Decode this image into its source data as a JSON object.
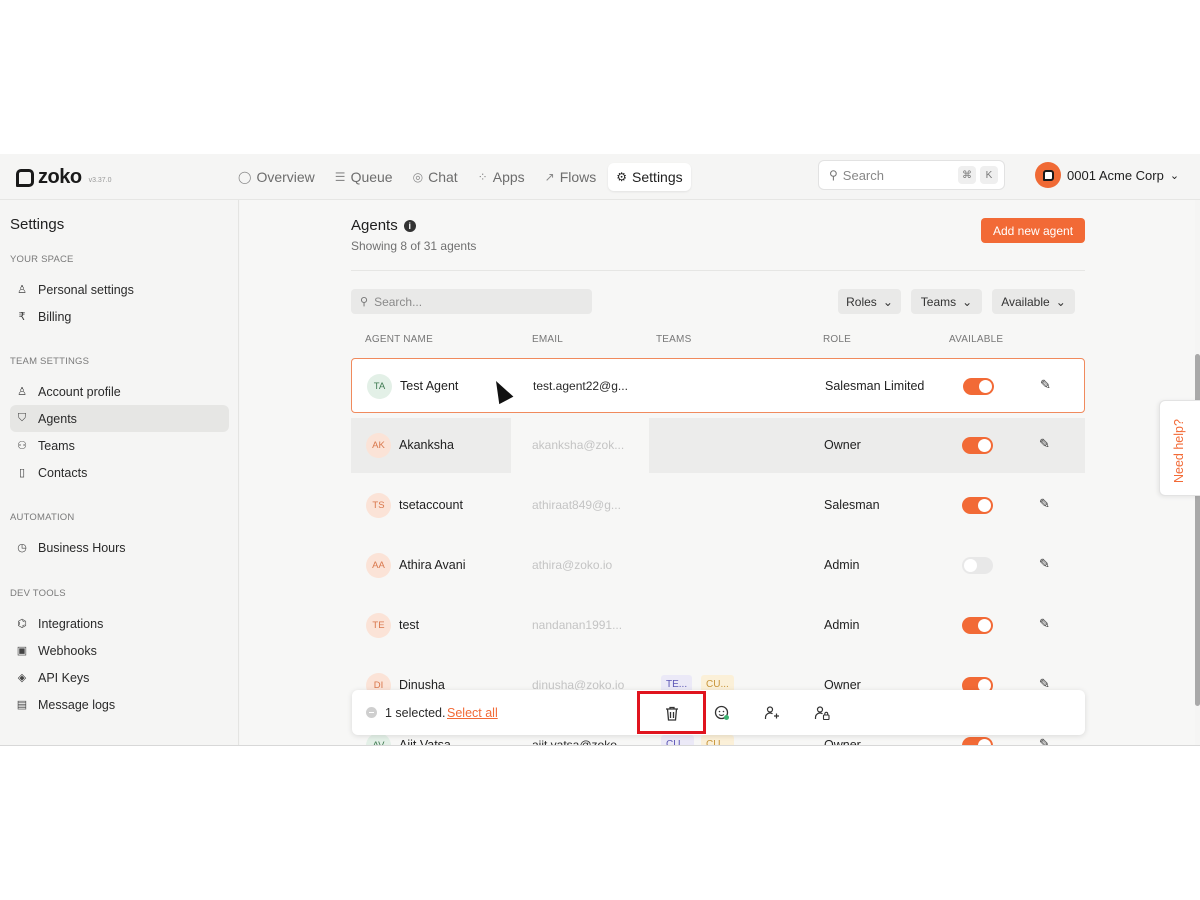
{
  "app": {
    "logo_text": "zoko",
    "version": "v3.37.0"
  },
  "nav": {
    "items": [
      {
        "label": "Overview",
        "icon": "circle-icon"
      },
      {
        "label": "Queue",
        "icon": "queue-icon"
      },
      {
        "label": "Chat",
        "icon": "chat-icon"
      },
      {
        "label": "Apps",
        "icon": "apps-icon"
      },
      {
        "label": "Flows",
        "icon": "flows-icon"
      },
      {
        "label": "Settings",
        "icon": "gear-icon",
        "active": true
      }
    ]
  },
  "top_search": {
    "placeholder": "Search",
    "shortcut_keys": [
      "⌘",
      "K"
    ]
  },
  "account": {
    "name": "0001 Acme Corp"
  },
  "sidebar": {
    "title": "Settings",
    "sections": [
      {
        "label": "YOUR SPACE",
        "items": [
          {
            "label": "Personal settings",
            "icon": "user-icon"
          },
          {
            "label": "Billing",
            "icon": "rupee-icon"
          }
        ]
      },
      {
        "label": "TEAM SETTINGS",
        "items": [
          {
            "label": "Account profile",
            "icon": "user-icon"
          },
          {
            "label": "Agents",
            "icon": "agent-icon",
            "active": true
          },
          {
            "label": "Teams",
            "icon": "team-icon"
          },
          {
            "label": "Contacts",
            "icon": "contact-icon"
          }
        ]
      },
      {
        "label": "AUTOMATION",
        "items": [
          {
            "label": "Business Hours",
            "icon": "clock-icon"
          }
        ]
      },
      {
        "label": "DEV TOOLS",
        "items": [
          {
            "label": "Integrations",
            "icon": "integrations-icon"
          },
          {
            "label": "Webhooks",
            "icon": "webhook-icon"
          },
          {
            "label": "API Keys",
            "icon": "key-icon"
          },
          {
            "label": "Message logs",
            "icon": "log-icon"
          }
        ]
      }
    ]
  },
  "main": {
    "title": "Agents",
    "subtitle": "Showing 8 of 31 agents",
    "add_button": "Add new agent",
    "search_placeholder": "Search...",
    "filters": [
      "Roles",
      "Teams",
      "Available"
    ],
    "columns": [
      "AGENT NAME",
      "EMAIL",
      "TEAMS",
      "ROLE",
      "AVAILABLE"
    ],
    "rows": [
      {
        "initials": "TA",
        "name": "Test Agent",
        "email": "test.agent22@g...",
        "teams": [],
        "role": "Salesman Limited",
        "available": true,
        "state": "selected"
      },
      {
        "initials": "AK",
        "name": "Akanksha",
        "email": "akanksha@zok...",
        "teams": [],
        "role": "Owner",
        "available": true,
        "state": "hovered"
      },
      {
        "initials": "TS",
        "name": "tsetaccount",
        "email": "athiraat849@g...",
        "teams": [],
        "role": "Salesman",
        "available": true
      },
      {
        "initials": "AA",
        "name": "Athira Avani",
        "email": "athira@zoko.io",
        "teams": [],
        "role": "Admin",
        "available": false
      },
      {
        "initials": "TE",
        "name": "test",
        "email": "nandanan1991...",
        "teams": [],
        "role": "Admin",
        "available": true
      },
      {
        "initials": "DI",
        "name": "Dinusha",
        "email": "dinusha@zoko.io",
        "teams": [
          "TE...",
          "CU..."
        ],
        "role": "Owner",
        "available": true
      },
      {
        "initials": "AV",
        "name": "Ajit Vatsa",
        "email": "ajit.vatsa@zoko...",
        "teams": [
          "CU...",
          "CU..."
        ],
        "role": "Owner",
        "available": true
      }
    ]
  },
  "bulk_bar": {
    "selected_text": "1 selected.",
    "select_all": "Select all",
    "actions": [
      "trash-icon",
      "availability-icon",
      "add-to-team-icon",
      "change-role-icon"
    ]
  },
  "help_tab": {
    "label": "Need help?"
  },
  "colors": {
    "accent": "#f26a36",
    "highlight": "#e0141e"
  }
}
